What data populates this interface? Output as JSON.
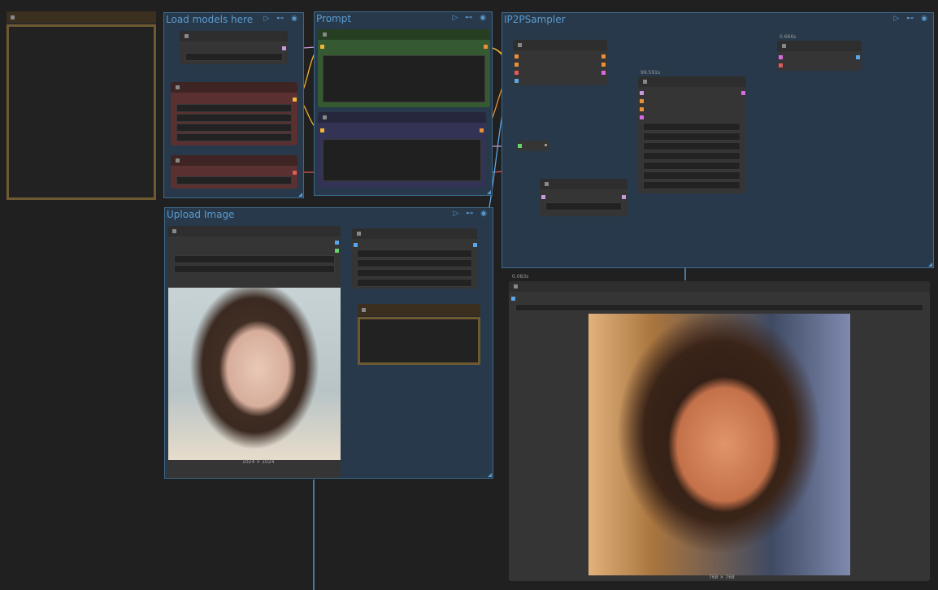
{
  "groups": {
    "load_models": {
      "title": "Load models here"
    },
    "prompt": {
      "title": "Prompt"
    },
    "sampler": {
      "title": "IP2PSampler"
    },
    "upload": {
      "title": "Upload Image"
    }
  },
  "group_icons": "▷ ⊷ ◉",
  "timings": {
    "top_right_node": "0.666s",
    "sampler_node": "99.591s",
    "preview_node": "0.083s"
  },
  "images": {
    "input_size": "1024 × 1024",
    "output_size": "768 × 768"
  },
  "colors": {
    "canvas_bg": "#202020",
    "group_bg": "#27394a",
    "group_border": "#3d6a8c",
    "group_title": "#5b9bd0",
    "positive_prompt": "#355a31",
    "negative_prompt": "#333355",
    "loader_red": "#5a3030",
    "note_brown": "#5e4a28"
  }
}
